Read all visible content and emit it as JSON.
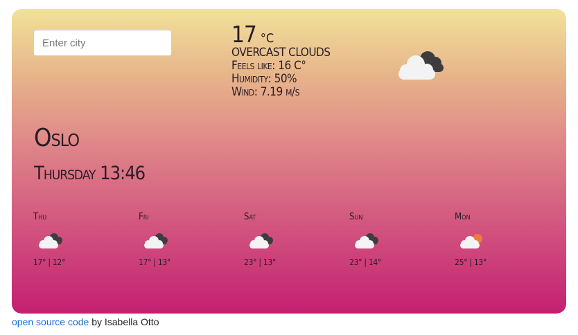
{
  "search": {
    "placeholder": "Enter city"
  },
  "current": {
    "temperature": "17",
    "unit": "°C",
    "condition": "overcast clouds",
    "feels_like": "Feels like: 16 C°",
    "humidity": "Humidity: 50%",
    "wind": "Wind: 7.19 m/s",
    "icon": "overcast-clouds-icon"
  },
  "location": {
    "city": "Oslo",
    "datetime": "Thursday 13:46"
  },
  "forecast": [
    {
      "day": "Thu",
      "temps": "17° | 12°",
      "icon": "overcast-clouds-icon"
    },
    {
      "day": "Fri",
      "temps": "17° | 13°",
      "icon": "overcast-clouds-icon"
    },
    {
      "day": "Sat",
      "temps": "23° | 13°",
      "icon": "overcast-clouds-icon"
    },
    {
      "day": "Sun",
      "temps": "23° | 14°",
      "icon": "overcast-clouds-icon"
    },
    {
      "day": "Mon",
      "temps": "25° | 13°",
      "icon": "partly-cloudy-sun-icon"
    }
  ],
  "footer": {
    "link_text": "open source code",
    "suffix": " by Isabella Otto"
  },
  "colors": {
    "gradient_top": "#f1e29a",
    "gradient_bottom": "#c41f72",
    "link": "#1a6fd1"
  }
}
